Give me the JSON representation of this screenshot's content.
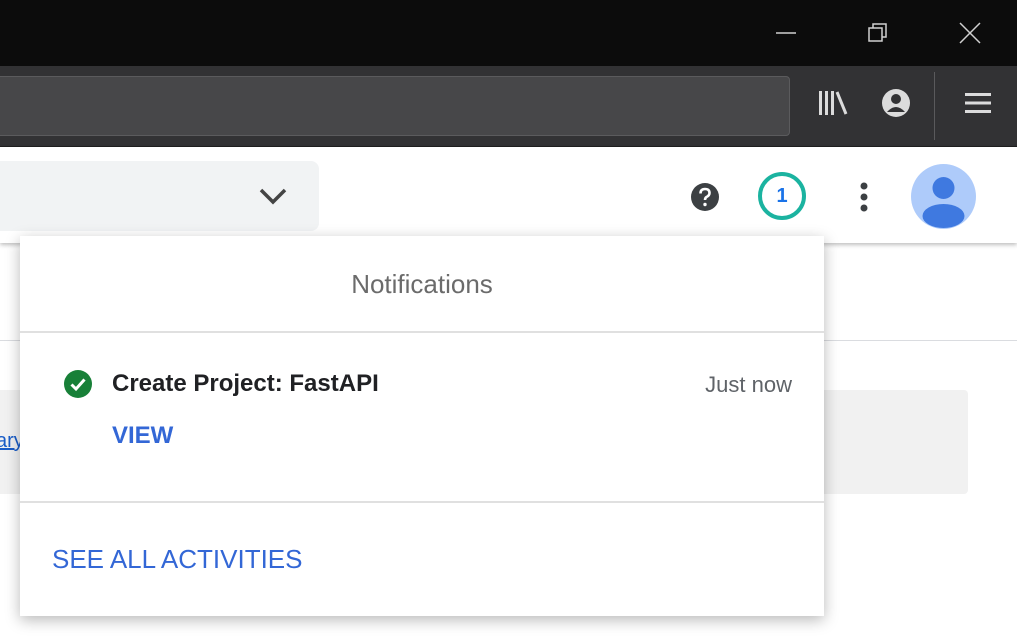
{
  "window": {
    "controls": [
      "minimize-icon",
      "restore-icon",
      "close-icon"
    ]
  },
  "toolbar": {
    "icons": [
      "library-icon",
      "account-icon",
      "menu-icon"
    ]
  },
  "appbar": {
    "icons": [
      "help-icon",
      "more-vert-icon",
      "avatar"
    ],
    "notification_count": "1",
    "badge_color": "#1bb3a0"
  },
  "background": {
    "link_fragment": "ary"
  },
  "notifications": {
    "title": "Notifications",
    "items": [
      {
        "status_icon": "check-circle-icon",
        "status_color": "#188038",
        "title": "Create Project: FastAPI",
        "time": "Just now",
        "action": "VIEW"
      }
    ],
    "see_all": "SEE ALL ACTIVITIES",
    "link_color": "#3367d6"
  }
}
